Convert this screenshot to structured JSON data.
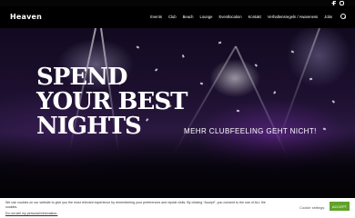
{
  "header": {
    "logo": "Heaven",
    "social": [
      "facebook-icon",
      "instagram-icon"
    ],
    "menu": [
      "Events",
      "Club",
      "Beach",
      "Lounge",
      "Eventlocation",
      "Kontakt",
      "Verhaltensregeln / Awareness",
      "Jobs"
    ]
  },
  "hero": {
    "headline": [
      "SPEND",
      "YOUR BEST",
      "NIGHTS"
    ],
    "tagline": "MEHR CLUBFEELING GEHT NICHT!"
  },
  "cookie": {
    "text": "We use cookies on our website to give you the most relevant experience by remembering your preferences and repeat visits. By clicking “Accept”, you consent to the use of ALL the cookies.",
    "optout": "Do not sell my personal information.",
    "settings": "Cookie settings",
    "accept": "ACCEPT",
    "accent_color": "#61a229"
  }
}
